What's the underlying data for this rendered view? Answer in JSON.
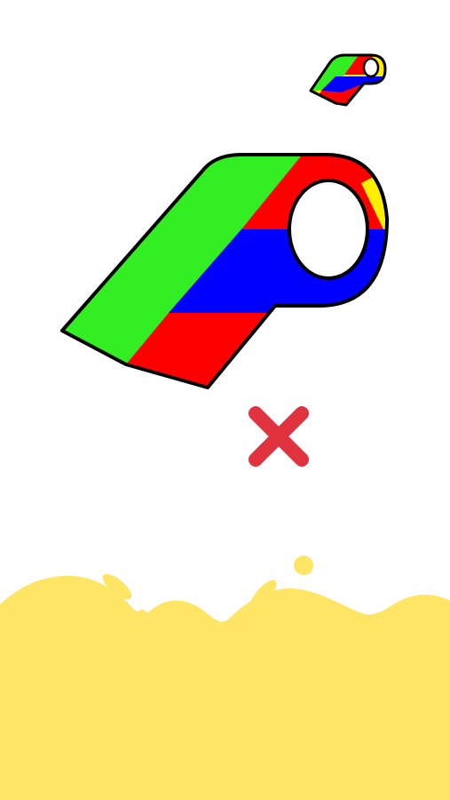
{
  "colors": {
    "background": "#ffffff",
    "green": "#33ee22",
    "red": "#ff0000",
    "blue": "#0000ff",
    "yellow": "#ffee00",
    "outline": "#000000",
    "mouth_hole": "#ffffff",
    "wrong_mark": "#e0333f",
    "paint": "#ffe566"
  },
  "target_preview": {
    "icon": "whistle-icon",
    "regions": [
      "yellow",
      "green",
      "red",
      "blue",
      "red",
      "green"
    ]
  },
  "whistle": {
    "icon": "whistle-icon",
    "regions": [
      "green",
      "red",
      "blue",
      "red",
      "yellow",
      "blue"
    ]
  },
  "feedback": {
    "icon": "close-icon",
    "state": "wrong"
  },
  "paint_pool": {
    "color": "yellow"
  }
}
